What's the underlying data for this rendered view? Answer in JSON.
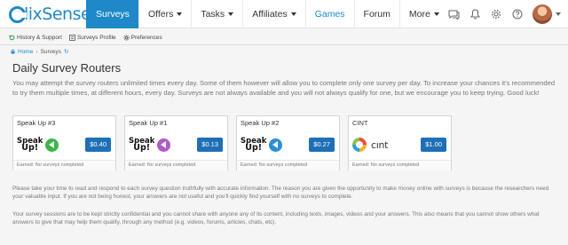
{
  "brand": {
    "name": "lixSense",
    "color": "#1e88c8"
  },
  "nav": {
    "items": [
      {
        "label": "Surveys",
        "dropdown": false,
        "active": true
      },
      {
        "label": "Offers",
        "dropdown": true,
        "active": false
      },
      {
        "label": "Tasks",
        "dropdown": true,
        "active": false
      },
      {
        "label": "Affiliates",
        "dropdown": true,
        "active": false
      },
      {
        "label": "Games",
        "dropdown": false,
        "active": false
      },
      {
        "label": "Forum",
        "dropdown": false,
        "active": false
      },
      {
        "label": "More",
        "dropdown": true,
        "active": false
      }
    ],
    "icons": [
      "chat-icon",
      "bell-icon",
      "gear-icon",
      "help-icon",
      "avatar"
    ]
  },
  "subnav": {
    "history": "History & Support",
    "profile": "Surveys Profile",
    "preferences": "Preferences"
  },
  "breadcrumb": {
    "home": "Home",
    "current": "Surveys"
  },
  "page": {
    "title": "Daily Survey Routers",
    "intro": "You may attempt the survey routers unlimited times every day. Some of them however will allow you to complete only one survey per day. To increase your chances it's recommended to try them multiple times, at different hours, every day. Surveys are not always available and you will not always qualify for one, but we encourage you to keep trying. Good luck!"
  },
  "routers": [
    {
      "name": "Speak Up #3",
      "logo": "speakup",
      "logo_text_1": "Speak",
      "logo_text_2": "Up!",
      "accent": "#3cb54a",
      "price": "$0.40",
      "status": "Earned: No surveys completed"
    },
    {
      "name": "Speak Up #1",
      "logo": "speakup",
      "logo_text_1": "Speak",
      "logo_text_2": "Up!",
      "accent": "#b05bc6",
      "price": "$0.13",
      "status": "Earned: No surveys completed"
    },
    {
      "name": "Speak Up #2",
      "logo": "speakup",
      "logo_text_1": "Speak",
      "logo_text_2": "Up!",
      "accent": "#2b8fd6",
      "price": "$0.27",
      "status": "Earned: No surveys completed"
    },
    {
      "name": "CINT",
      "logo": "cint",
      "logo_text_1": "cınt",
      "logo_text_2": "",
      "accent": "#2a9fd8",
      "price": "$1.00",
      "status": "Earned: No surveys completed"
    }
  ],
  "notes": {
    "first": "Please take your time to read and respond to each survey question truthfully with accurate information. The reason you are given the opportunity to make money online with surveys is because the researchers need your valuable input. If you are not being honest, your answers are not useful and you'll quickly find yourself with no surveys to complete.",
    "second": "Your survey sessions are to be kept strictly confidential and you cannot share with anyone any of its content, including texts, images, videos and your answers. This also means that you cannot show others what answers to give that may help them qualify, through any method (e.g. videos, forums, articles, chats, etc)."
  }
}
